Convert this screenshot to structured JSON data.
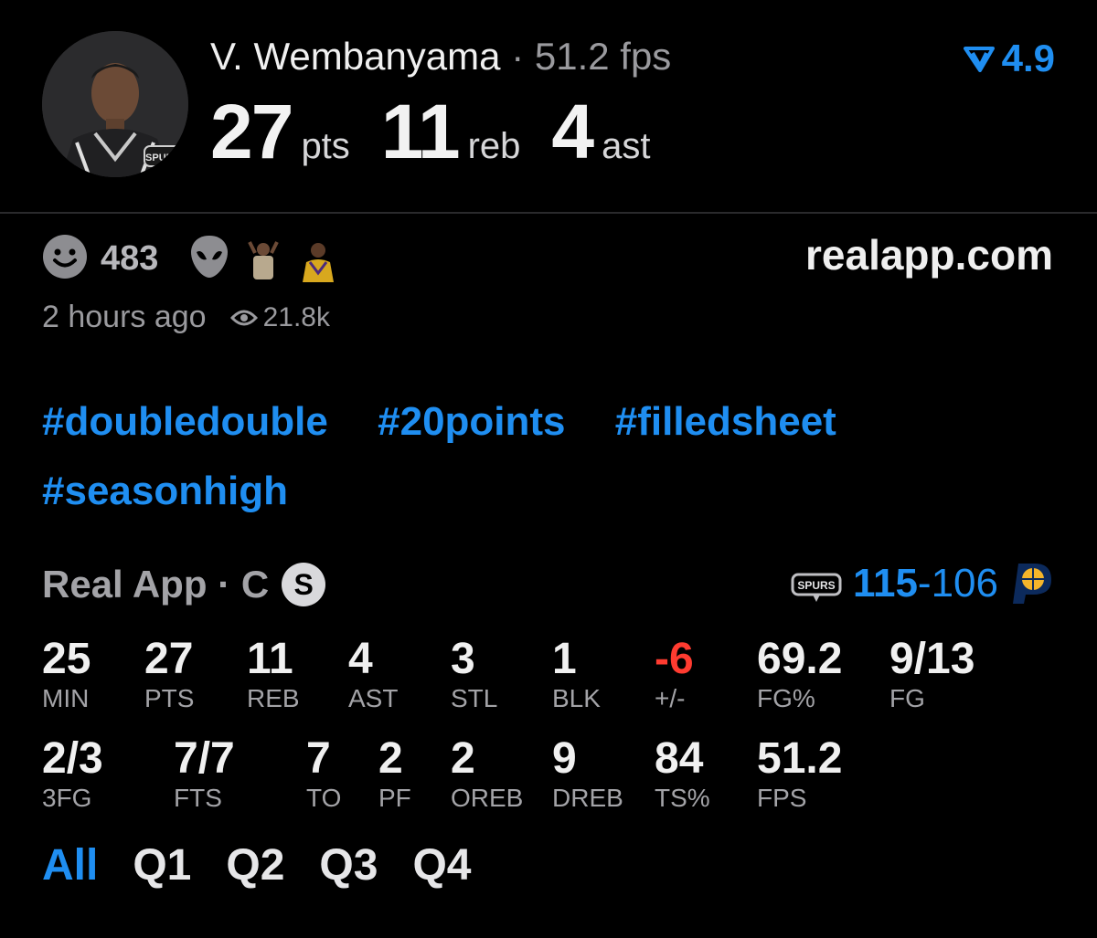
{
  "header": {
    "player_name": "V. Wembanyama",
    "separator": "·",
    "fps": "51.2 fps",
    "rating": "4.9",
    "big_stats": [
      {
        "value": "27",
        "label": "pts"
      },
      {
        "value": "11",
        "label": "reb"
      },
      {
        "value": "4",
        "label": "ast"
      }
    ],
    "team_logo_text": "SPURS"
  },
  "reactions": {
    "count": "483",
    "icons": [
      "smiley-icon",
      "alien-icon",
      "player-reaction-thumb",
      "player-reaction-thumb"
    ],
    "site": "realapp.com",
    "time_ago": "2 hours ago",
    "views": "21.8k"
  },
  "hashtags": [
    "#doubledouble",
    "#20points",
    "#filledsheet",
    "#seasonhigh"
  ],
  "game": {
    "source": "Real App",
    "separator": "·",
    "position": "C",
    "badge": "S",
    "home_logo_text": "SPURS",
    "home_score": "115",
    "dash": "-",
    "away_score": "106",
    "away_logo_text": "P"
  },
  "stats_row1": [
    {
      "value": "25",
      "label": "MIN"
    },
    {
      "value": "27",
      "label": "PTS"
    },
    {
      "value": "11",
      "label": "REB"
    },
    {
      "value": "4",
      "label": "AST"
    },
    {
      "value": "3",
      "label": "STL"
    },
    {
      "value": "1",
      "label": "BLK"
    },
    {
      "value": "-6",
      "label": "+/-"
    },
    {
      "value": "69.2",
      "label": "FG%"
    },
    {
      "value": "9/13",
      "label": "FG"
    }
  ],
  "stats_row2": [
    {
      "value": "2/3",
      "label": "3FG"
    },
    {
      "value": "7/7",
      "label": "FTS"
    },
    {
      "value": "7",
      "label": "TO"
    },
    {
      "value": "2",
      "label": "PF"
    },
    {
      "value": "2",
      "label": "OREB"
    },
    {
      "value": "9",
      "label": "DREB"
    },
    {
      "value": "84",
      "label": "TS%"
    },
    {
      "value": "51.2",
      "label": "FPS"
    }
  ],
  "tabs": [
    "All",
    "Q1",
    "Q2",
    "Q3",
    "Q4"
  ],
  "colors": {
    "accent": "#1f8ef1",
    "negative": "#ff3b30",
    "muted": "#9a9a9e"
  }
}
